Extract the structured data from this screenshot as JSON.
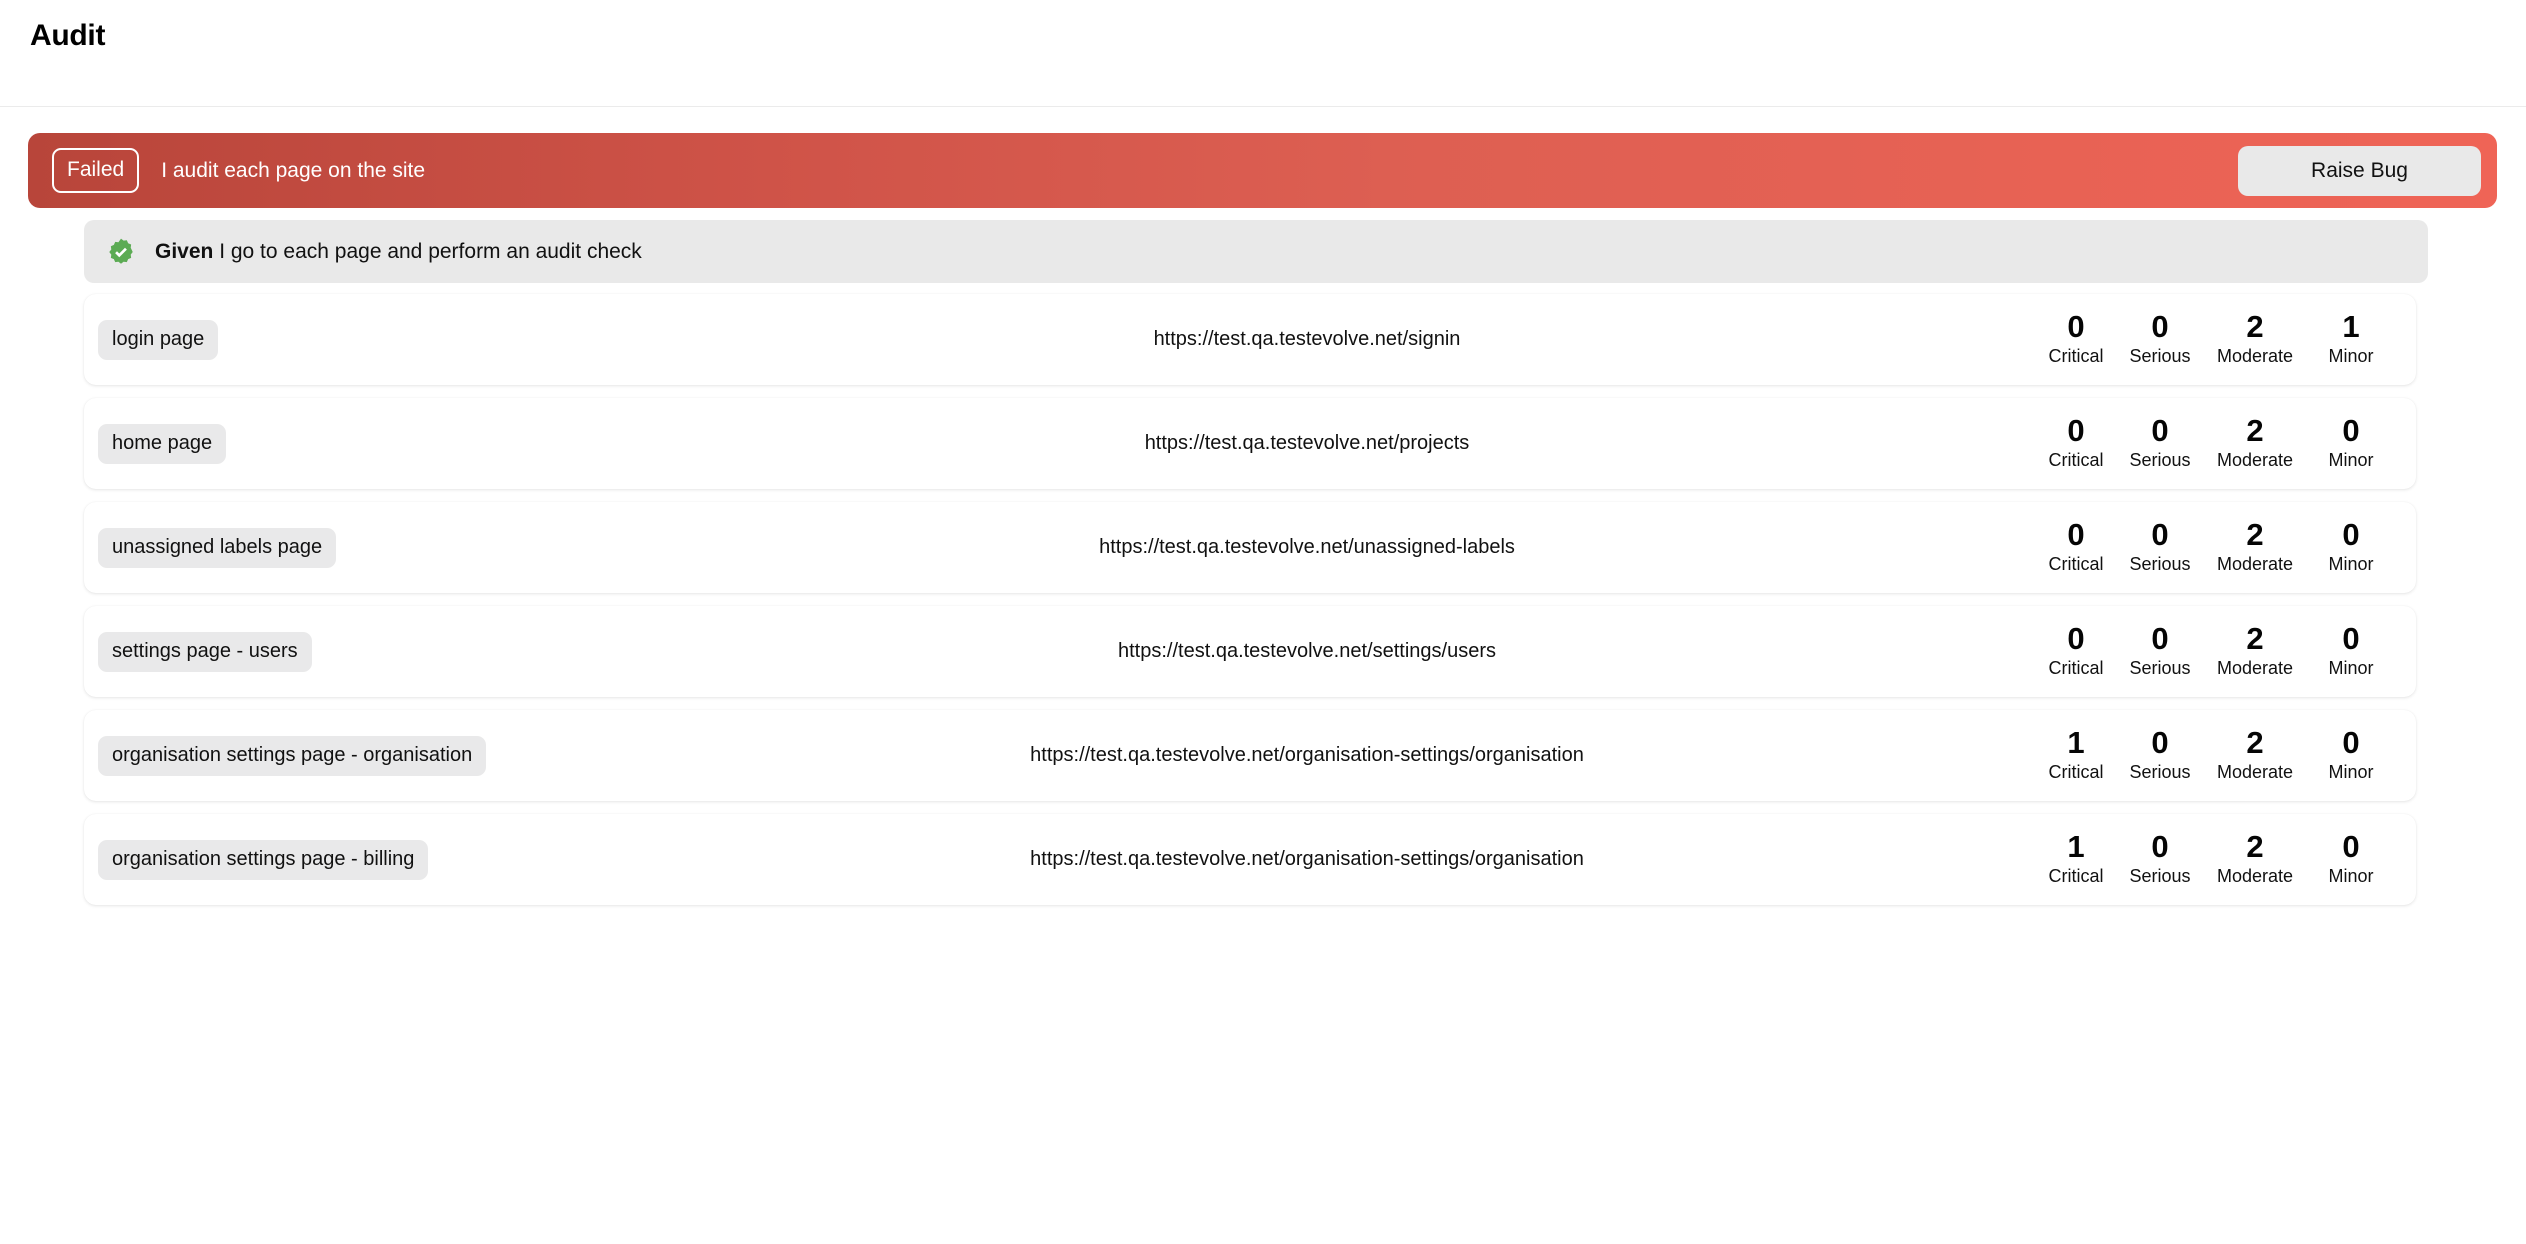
{
  "header": {
    "title": "Audit"
  },
  "scenario": {
    "status_label": "Failed",
    "name": "I audit each page on the site",
    "raise_bug_label": "Raise Bug",
    "status_color": "#b8453a",
    "gradient_end_color": "#ef6456"
  },
  "step": {
    "keyword": "Given",
    "text": " I go to each page and perform an audit check",
    "badge_icon": "check-badge-icon",
    "badge_color": "#5cab54"
  },
  "severity_labels": {
    "critical": "Critical",
    "serious": "Serious",
    "moderate": "Moderate",
    "minor": "Minor"
  },
  "results": [
    {
      "tag": "login page",
      "url": "https://test.qa.testevolve.net/signin",
      "critical": "0",
      "serious": "0",
      "moderate": "2",
      "minor": "1"
    },
    {
      "tag": "home page",
      "url": "https://test.qa.testevolve.net/projects",
      "critical": "0",
      "serious": "0",
      "moderate": "2",
      "minor": "0"
    },
    {
      "tag": "unassigned labels page",
      "url": "https://test.qa.testevolve.net/unassigned-labels",
      "critical": "0",
      "serious": "0",
      "moderate": "2",
      "minor": "0"
    },
    {
      "tag": "settings page - users",
      "url": "https://test.qa.testevolve.net/settings/users",
      "critical": "0",
      "serious": "0",
      "moderate": "2",
      "minor": "0"
    },
    {
      "tag": "organisation settings page - organisation",
      "url": "https://test.qa.testevolve.net/organisation-settings/organisation",
      "critical": "1",
      "serious": "0",
      "moderate": "2",
      "minor": "0"
    },
    {
      "tag": "organisation settings page - billing",
      "url": "https://test.qa.testevolve.net/organisation-settings/organisation",
      "critical": "1",
      "serious": "0",
      "moderate": "2",
      "minor": "0"
    }
  ]
}
